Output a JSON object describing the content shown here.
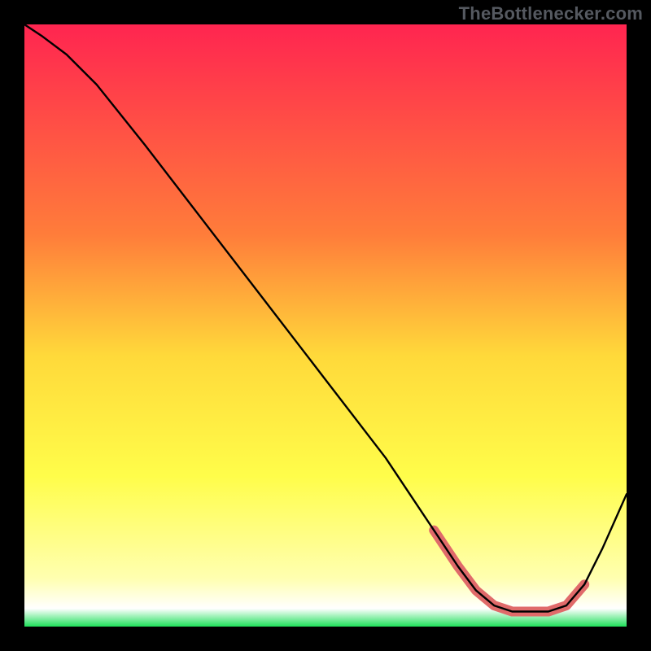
{
  "watermark": "TheBottlenecker.com",
  "chart_data": {
    "type": "line",
    "title": "",
    "xlabel": "",
    "ylabel": "",
    "xlim": [
      0,
      100
    ],
    "ylim": [
      0,
      100
    ],
    "legend": false,
    "grid": false,
    "gradient_stops": [
      {
        "offset": 0,
        "color": "#ff2550"
      },
      {
        "offset": 35,
        "color": "#ff7d3a"
      },
      {
        "offset": 55,
        "color": "#ffd93a"
      },
      {
        "offset": 75,
        "color": "#fffd4a"
      },
      {
        "offset": 92,
        "color": "#ffffb0"
      },
      {
        "offset": 97,
        "color": "#ffffff"
      },
      {
        "offset": 100,
        "color": "#1fe05a"
      }
    ],
    "series": [
      {
        "name": "curve",
        "stroke": "#000000",
        "stroke_width": 2.4,
        "x": [
          0,
          3,
          7,
          12,
          20,
          30,
          40,
          50,
          60,
          68,
          72,
          75,
          78,
          81,
          84,
          87,
          90,
          93,
          96,
          100
        ],
        "y": [
          100,
          98,
          95,
          90,
          80,
          67,
          54,
          41,
          28,
          16,
          10,
          6,
          3.5,
          2.5,
          2.5,
          2.5,
          3.5,
          7,
          13,
          22
        ]
      },
      {
        "name": "highlight",
        "stroke": "#e06a6a",
        "stroke_width": 12,
        "linecap": "round",
        "x": [
          68,
          72,
          75,
          78,
          81,
          84,
          87,
          90,
          93
        ],
        "y": [
          16,
          10,
          6,
          3.5,
          2.5,
          2.5,
          2.5,
          3.5,
          7
        ]
      }
    ]
  }
}
